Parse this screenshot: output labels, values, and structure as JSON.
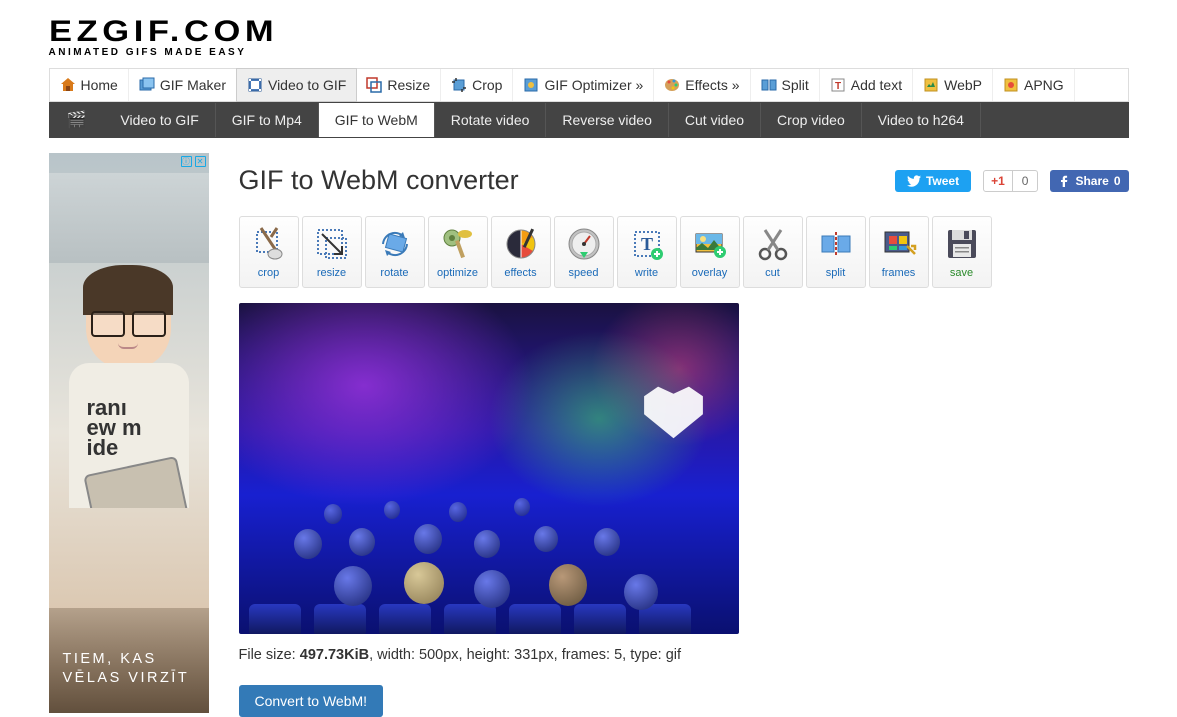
{
  "logo": {
    "main": "EZGIF.COM",
    "sub": "ANIMATED GIFS MADE EASY"
  },
  "mainNav": [
    {
      "label": "Home"
    },
    {
      "label": "GIF Maker"
    },
    {
      "label": "Video to GIF"
    },
    {
      "label": "Resize"
    },
    {
      "label": "Crop"
    },
    {
      "label": "GIF Optimizer »"
    },
    {
      "label": "Effects »"
    },
    {
      "label": "Split"
    },
    {
      "label": "Add text"
    },
    {
      "label": "WebP"
    },
    {
      "label": "APNG"
    }
  ],
  "subNav": [
    {
      "label": "Video to GIF"
    },
    {
      "label": "GIF to Mp4"
    },
    {
      "label": "GIF to WebM"
    },
    {
      "label": "Rotate video"
    },
    {
      "label": "Reverse video"
    },
    {
      "label": "Cut video"
    },
    {
      "label": "Crop video"
    },
    {
      "label": "Video to h264"
    }
  ],
  "ad": {
    "badge_left": "ⓘ",
    "badge_right": "✕",
    "shirt_line1": "ranı",
    "shirt_line2": "ew m",
    "shirt_line3": "ide",
    "text_line1": "TIEM, KAS",
    "text_line2": "VĒLAS VIRZĪT"
  },
  "page": {
    "title": "GIF to WebM converter"
  },
  "share": {
    "tweet": "Tweet",
    "gplus_label": "+1",
    "gplus_count": "0",
    "fb_label": "Share",
    "fb_count": "0"
  },
  "tools": [
    {
      "label": "crop"
    },
    {
      "label": "resize"
    },
    {
      "label": "rotate"
    },
    {
      "label": "optimize"
    },
    {
      "label": "effects"
    },
    {
      "label": "speed"
    },
    {
      "label": "write"
    },
    {
      "label": "overlay"
    },
    {
      "label": "cut"
    },
    {
      "label": "split"
    },
    {
      "label": "frames"
    },
    {
      "label": "save"
    }
  ],
  "fileInfo": {
    "prefix": "File size: ",
    "size": "497.73KiB",
    "rest": ", width: 500px, height: 331px, frames: 5, type: gif"
  },
  "convert": {
    "label": "Convert to WebM!"
  }
}
